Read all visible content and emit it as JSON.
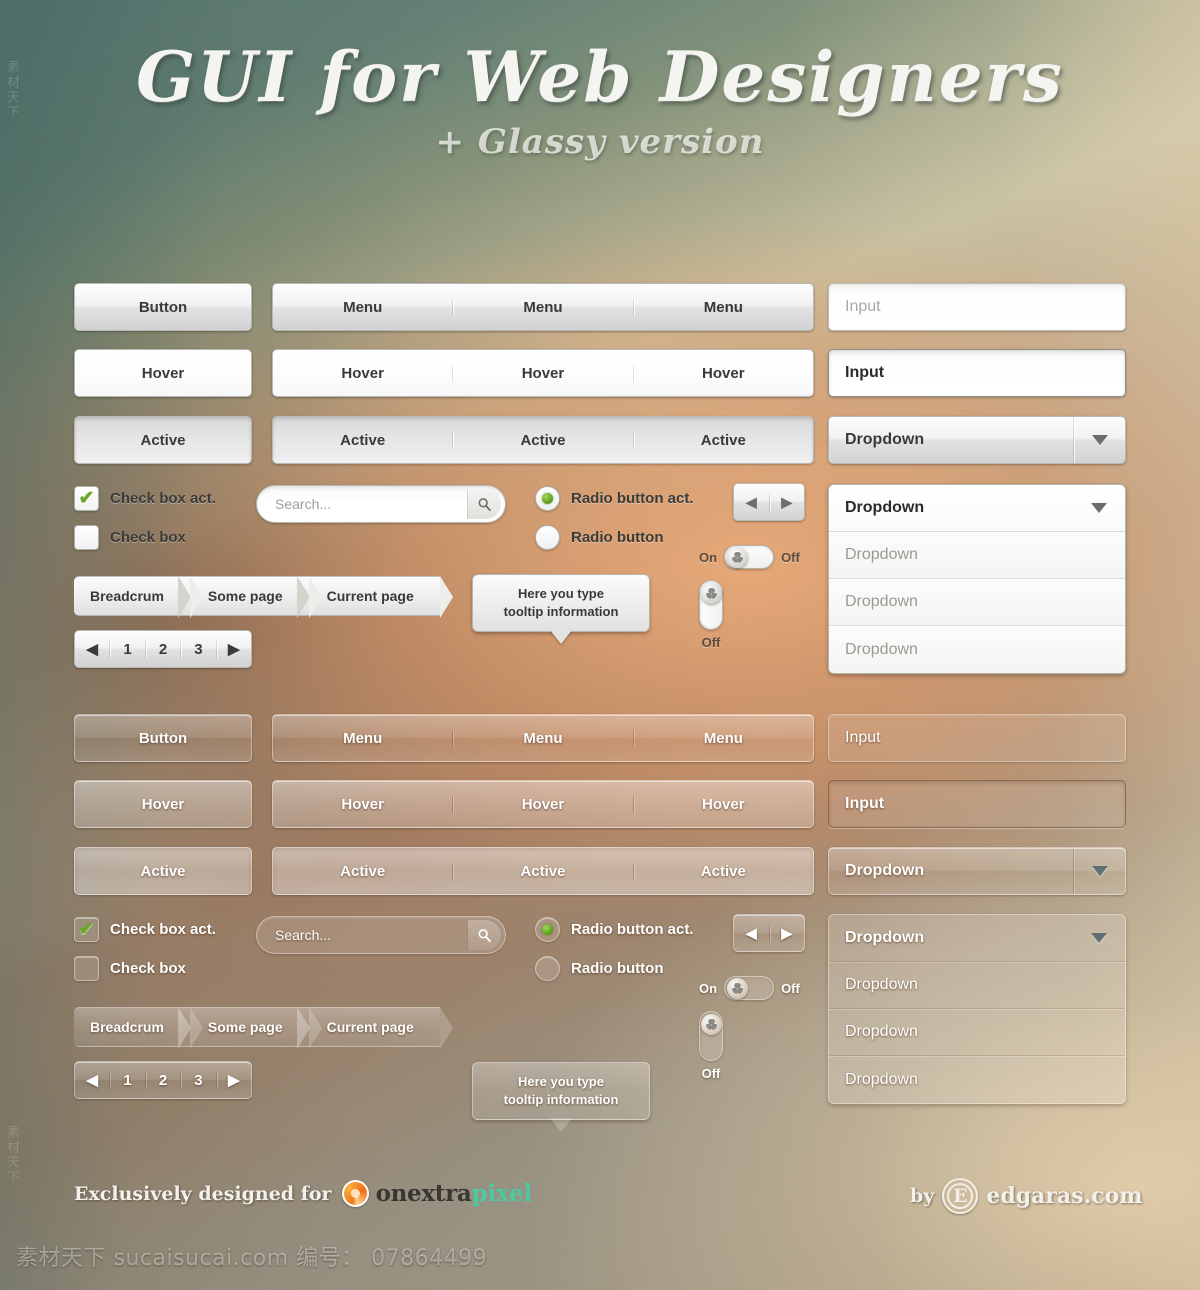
{
  "header": {
    "title": "GUI for Web Designers",
    "subtitle": "+ Glassy version"
  },
  "kits": [
    {
      "style": "light",
      "button": {
        "default": "Button",
        "hover": "Hover",
        "active": "Active"
      },
      "menu": {
        "row_default": [
          "Menu",
          "Menu",
          "Menu"
        ],
        "row_hover": [
          "Hover",
          "Hover",
          "Hover"
        ],
        "row_active": [
          "Active",
          "Active",
          "Active"
        ]
      },
      "input": {
        "placeholder": "Input",
        "filled": "Input"
      },
      "dropdown_closed": "Dropdown",
      "dropdown_list": [
        "Dropdown",
        "Dropdown",
        "Dropdown",
        "Dropdown"
      ],
      "checkbox": {
        "checked_label": "Check box act.",
        "unchecked_label": "Check box",
        "check_glyph": "✔"
      },
      "search": {
        "placeholder": "Search...",
        "icon": "search-icon"
      },
      "radio": {
        "active_label": "Radio button act.",
        "inactive_label": "Radio button"
      },
      "arrows": {
        "prev": "◀",
        "next": "▶"
      },
      "toggle_horizontal": {
        "on_label": "On",
        "off_label": "Off"
      },
      "toggle_vertical": {
        "off_label": "Off"
      },
      "breadcrumb": [
        "Breadcrum",
        "Some page",
        "Current page"
      ],
      "pagination": {
        "prev": "◀",
        "pages": [
          "1",
          "2",
          "3"
        ],
        "next": "▶"
      },
      "tooltip": {
        "line1": "Here you type",
        "line2": "tooltip information"
      }
    },
    {
      "style": "glassy",
      "button": {
        "default": "Button",
        "hover": "Hover",
        "active": "Active"
      },
      "menu": {
        "row_default": [
          "Menu",
          "Menu",
          "Menu"
        ],
        "row_hover": [
          "Hover",
          "Hover",
          "Hover"
        ],
        "row_active": [
          "Active",
          "Active",
          "Active"
        ]
      },
      "input": {
        "placeholder": "Input",
        "filled": "Input"
      },
      "dropdown_closed": "Dropdown",
      "dropdown_list": [
        "Dropdown",
        "Dropdown",
        "Dropdown",
        "Dropdown"
      ],
      "checkbox": {
        "checked_label": "Check box act.",
        "unchecked_label": "Check box",
        "check_glyph": "✔"
      },
      "search": {
        "placeholder": "Search...",
        "icon": "search-icon"
      },
      "radio": {
        "active_label": "Radio button act.",
        "inactive_label": "Radio button"
      },
      "arrows": {
        "prev": "◀",
        "next": "▶"
      },
      "toggle_horizontal": {
        "on_label": "On",
        "off_label": "Off"
      },
      "toggle_vertical": {
        "off_label": "Off"
      },
      "breadcrumb": [
        "Breadcrum",
        "Some page",
        "Current page"
      ],
      "pagination": {
        "prev": "◀",
        "pages": [
          "1",
          "2",
          "3"
        ],
        "next": "▶"
      },
      "tooltip": {
        "line1": "Here you type",
        "line2": "tooltip information"
      }
    }
  ],
  "footer": {
    "credit_prefix": "Exclusively designed for",
    "brand_part1": "onextra",
    "brand_part2": "pixel",
    "by_label": "by",
    "author_mark": "E",
    "author_site": "edgaras.com"
  },
  "watermark": {
    "bottom": "素材天下 sucaisucai.com  编号： 07864499",
    "side": "素材天下",
    "side2": "素材天下"
  },
  "colors": {
    "accent_green": "#6aa827",
    "brand_orange": "#f07a18",
    "brand_teal": "#4dc9a2",
    "bg_top_left": "#4d6e69",
    "bg_mid_warm": "#e2a070",
    "bg_bottom_right": "#e4d5b8"
  }
}
